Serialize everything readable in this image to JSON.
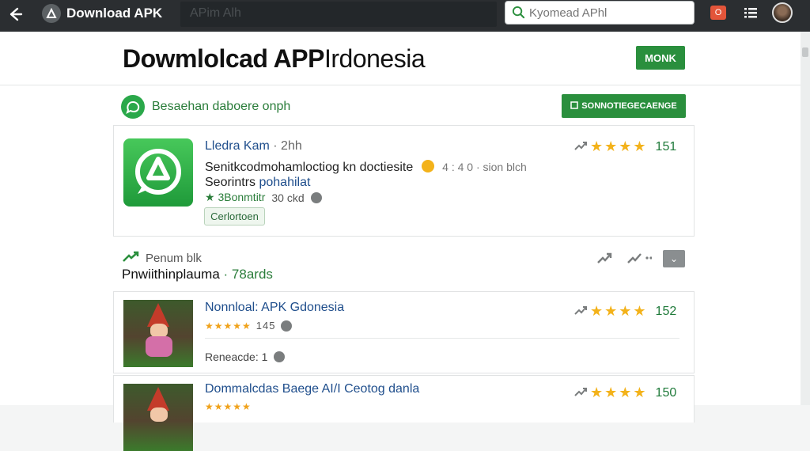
{
  "topbar": {
    "app_title": "Download APK",
    "tab_field": "APim Alh",
    "search_placeholder": "Kyomead APhl",
    "notif_label": "O"
  },
  "header": {
    "title_bold": "Dowmlolcad APP",
    "title_light": "Irdonesia",
    "cta_label": "MONK"
  },
  "promo": {
    "text": "Besaehan daboere onph",
    "button_label": "SONNOTIEGECAENGE"
  },
  "featured_app": {
    "name": "Lledra Kam",
    "age": "· 2hh",
    "desc_line1": "Senitkcodmohamloctiog kn doctiesite",
    "desc_extra": "4 : 4 0 · sion blch",
    "desc_line2": "Seorintrs",
    "desc_link": "pohahilat",
    "rating_count": "151",
    "meta_downloads": "★ 3Bonmtitr",
    "meta_size": "30 ckd",
    "tag_label": "Cerlortoen"
  },
  "section": {
    "kicker": "Penum blk",
    "title": "Pnwiithinplauma",
    "count": "· 78ards"
  },
  "list": [
    {
      "name": "Nonnloal: APK  Gdonesia",
      "stars": "★★★★★",
      "stars_num": "145",
      "rating_count": "152",
      "downloads": "Reneacde: 1"
    },
    {
      "name": "Dommalcdas Baege AI/I Ceotog danla",
      "stars": "★★★★★",
      "rating_count": "150"
    }
  ],
  "colors": {
    "topbar": "#2b2e31",
    "accent_green": "#2a8f3d",
    "star": "#f3b21a",
    "link_blue": "#1f4e8c"
  }
}
